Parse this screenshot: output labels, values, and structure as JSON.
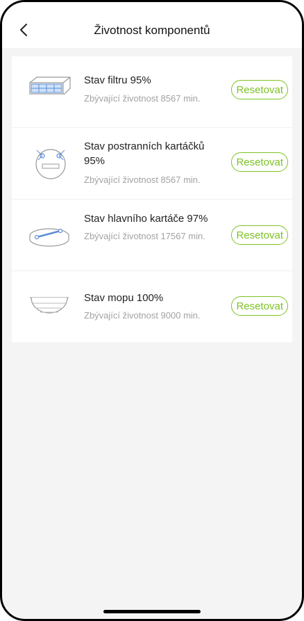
{
  "header": {
    "title": "Životnost komponentů"
  },
  "items": [
    {
      "label": "Stav filtru 95%",
      "sub": "Zbývající životnost 8567 min.",
      "button": "Resetovat",
      "icon": "filter-icon"
    },
    {
      "label": "Stav postranních kartáčků 95%",
      "sub": "Zbývající životnost 8567 min.",
      "button": "Resetovat",
      "icon": "side-brush-icon"
    },
    {
      "label": "Stav hlavního kartáče 97%",
      "sub": "Zbývající životnost 17567 min.",
      "button": "Resetovat",
      "icon": "main-brush-icon"
    },
    {
      "label": "Stav mopu 100%",
      "sub": "Zbývající životnost 9000 min.",
      "button": "Resetovat",
      "icon": "mop-icon"
    }
  ],
  "colors": {
    "accent": "#7cc324",
    "subtext": "#a2a2a2",
    "background": "#f4f4f4"
  }
}
